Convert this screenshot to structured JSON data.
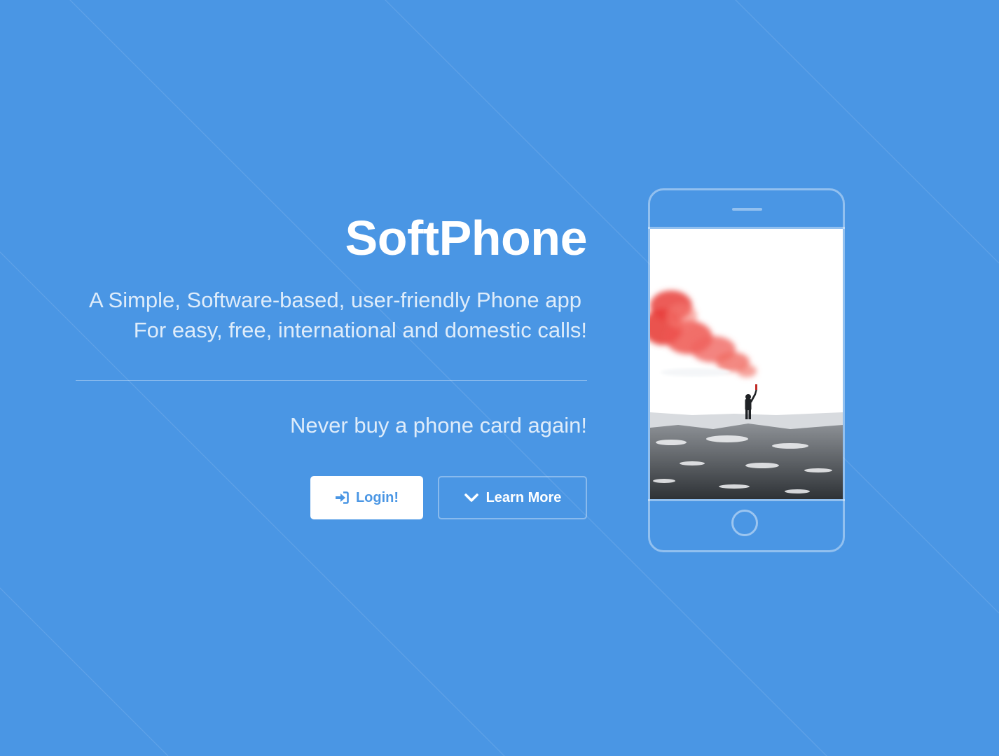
{
  "hero": {
    "title": "SoftPhone",
    "subtitle_line1": "A Simple, Software-based, user-friendly Phone app",
    "subtitle_line2": "For easy, free, international and domestic calls!",
    "tagline": "Never buy a phone card again!"
  },
  "buttons": {
    "login_label": "Login!",
    "login_icon": "sign-in-icon",
    "learn_more_label": "Learn More",
    "learn_more_icon": "chevron-down-icon"
  },
  "phone": {
    "screen_image": "person-holding-red-smoke-flare-on-snowy-shore"
  },
  "colors": {
    "background": "#4a96e4",
    "button_text": "#4a96e4",
    "white": "#ffffff"
  }
}
